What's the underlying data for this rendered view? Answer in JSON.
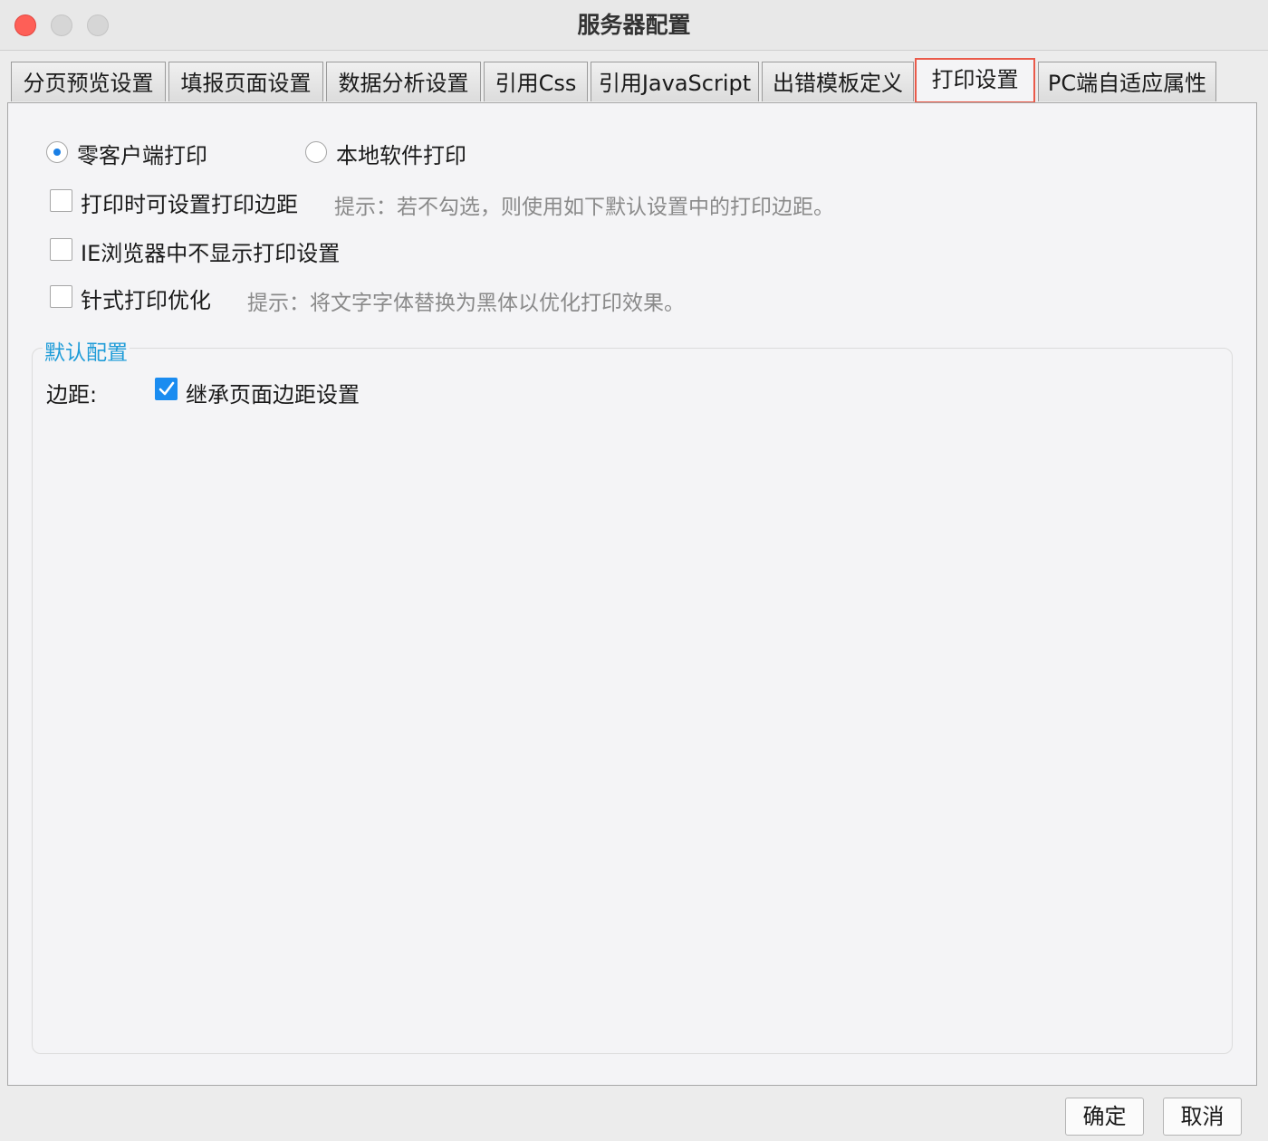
{
  "window": {
    "title": "服务器配置"
  },
  "tabs": [
    {
      "label": "分页预览设置"
    },
    {
      "label": "填报页面设置"
    },
    {
      "label": "数据分析设置"
    },
    {
      "label": "引用Css"
    },
    {
      "label": "引用JavaScript"
    },
    {
      "label": "出错模板定义"
    },
    {
      "label": "打印设置",
      "active": true
    },
    {
      "label": "PC端自适应属性"
    }
  ],
  "print_mode": {
    "zero_client": {
      "label": "零客户端打印",
      "selected": true
    },
    "local_software": {
      "label": "本地软件打印",
      "selected": false
    }
  },
  "options": {
    "margin_setting": {
      "label": "打印时可设置打印边距",
      "checked": false,
      "hint": "提示：若不勾选，则使用如下默认设置中的打印边距。"
    },
    "ie_hide": {
      "label": "IE浏览器中不显示打印设置",
      "checked": false
    },
    "dot_matrix": {
      "label": "针式打印优化",
      "checked": false,
      "hint": "提示：将文字字体替换为黑体以优化打印效果。"
    }
  },
  "default_config": {
    "legend": "默认配置",
    "margin_label": "边距:",
    "inherit_label": "继承页面边距设置",
    "inherit_checked": true
  },
  "buttons": {
    "ok": "确定",
    "cancel": "取消"
  },
  "colors": {
    "active_tab_border": "#ea5a4a",
    "accent_blue": "#1a8cf0",
    "legend_blue": "#1f9cd8",
    "close_red": "#fe5f57"
  }
}
